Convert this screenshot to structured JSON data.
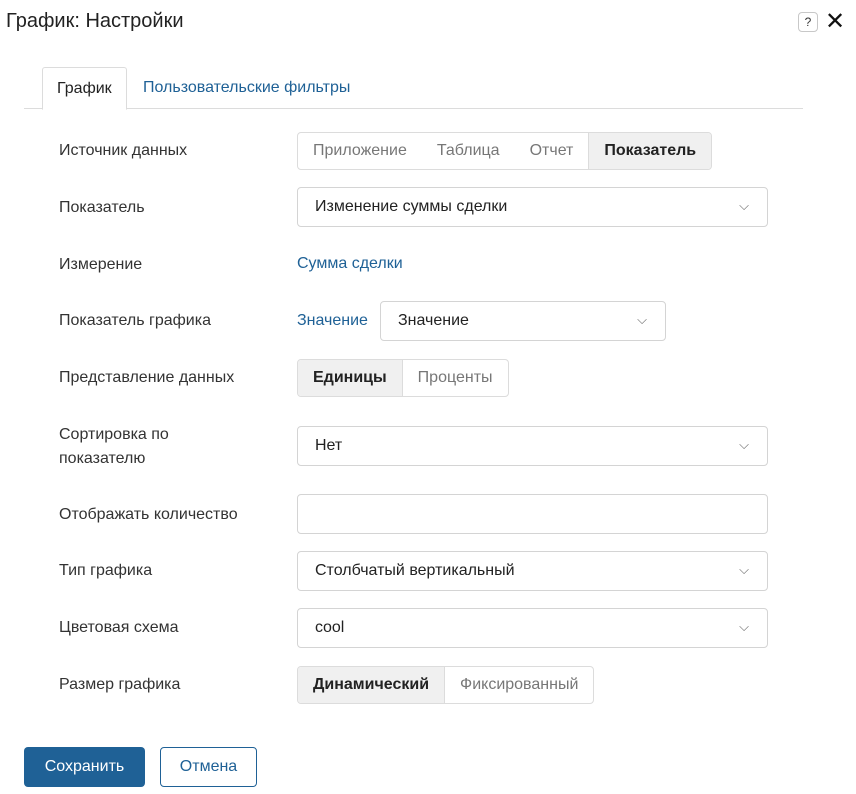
{
  "dialog": {
    "title": "График: Настройки",
    "help_glyph": "?",
    "close_glyph": "✕"
  },
  "tabs": [
    {
      "label": "График",
      "active": true
    },
    {
      "label": "Пользовательские фильтры",
      "active": false
    }
  ],
  "form": {
    "data_source": {
      "label": "Источник данных",
      "options": [
        "Приложение",
        "Таблица",
        "Отчет",
        "Показатель"
      ],
      "selected": "Показатель"
    },
    "indicator": {
      "label": "Показатель",
      "value": "Изменение суммы сделки"
    },
    "dimension": {
      "label": "Измерение",
      "value": "Сумма сделки"
    },
    "chart_indicator": {
      "label": "Показатель графика",
      "link": "Значение",
      "value": "Значение"
    },
    "data_view": {
      "label": "Представление данных",
      "options": [
        "Единицы",
        "Проценты"
      ],
      "selected": "Единицы"
    },
    "sort": {
      "label_line1": "Сортировка по",
      "label_line2": "показателю",
      "value": "Нет"
    },
    "count": {
      "label": "Отображать количество",
      "value": "",
      "placeholder": ""
    },
    "chart_type": {
      "label": "Тип графика",
      "value": "Столбчатый вертикальный"
    },
    "color_scheme": {
      "label": "Цветовая схема",
      "value": "cool"
    },
    "chart_size": {
      "label": "Размер графика",
      "options": [
        "Динамический",
        "Фиксированный"
      ],
      "selected": "Динамический"
    }
  },
  "footer": {
    "save_label": "Сохранить",
    "cancel_label": "Отмена"
  },
  "colors": {
    "accent": "#1f6196",
    "selected_segment": "#f0f0f0",
    "border": "#dcdcdc"
  }
}
